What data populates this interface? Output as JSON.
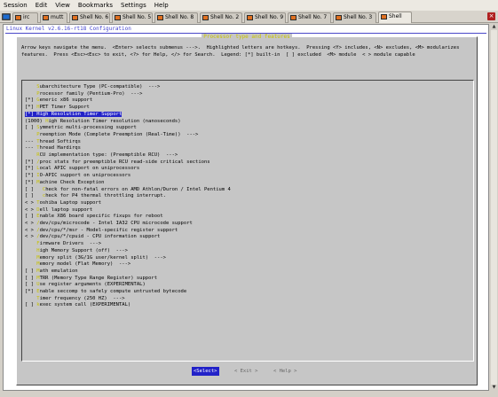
{
  "menubar": [
    "Session",
    "Edit",
    "View",
    "Bookmarks",
    "Settings",
    "Help"
  ],
  "tabs": [
    {
      "label": "irc",
      "active": false
    },
    {
      "label": "mutt",
      "active": false
    },
    {
      "label": "Shell No. 6",
      "active": false
    },
    {
      "label": "Shell No. 5",
      "active": false
    },
    {
      "label": "Shell No. 8",
      "active": false
    },
    {
      "label": "Shell No. 2",
      "active": false
    },
    {
      "label": "Shell No. 9",
      "active": false
    },
    {
      "label": "Shell No. 7",
      "active": false
    },
    {
      "label": "Shell No. 3",
      "active": false
    },
    {
      "label": "Shell",
      "active": true
    }
  ],
  "terminal": {
    "title": "Linux Kernel v2.6.16-rt18 Configuration",
    "dialog_title": "Processor type and features",
    "help": "Arrow keys navigate the menu.  <Enter> selects submenus --->.  Highlighted letters are hotkeys.  Pressing <Y> includes, <N> excludes, <M> modularizes features.  Press <Esc><Esc> to exit, <?> for Help, </> for Search.  Legend: [*] built-in  [ ] excluded  <M> module  < > module capable",
    "items": [
      {
        "prefix": "    ",
        "hotkey": "S",
        "text": "ubarchitecture Type (PC-compatible)  --->",
        "selected": false
      },
      {
        "prefix": "    ",
        "hotkey": "P",
        "text": "rocessor family (Pentium-Pro)  --->",
        "selected": false
      },
      {
        "prefix": "[*] ",
        "hotkey": "G",
        "text": "eneric x86 support",
        "selected": false
      },
      {
        "prefix": "[*] ",
        "hotkey": "H",
        "text": "PET Timer Support",
        "selected": false
      },
      {
        "prefix": "[*] ",
        "hotkey": "H",
        "text": "igh Resolution Timer Support",
        "selected": true
      },
      {
        "prefix": "(1000) ",
        "hotkey": "H",
        "text": "igh Resolution Timer resolution (nanoseconds)",
        "selected": false
      },
      {
        "prefix": "[ ] ",
        "hotkey": "S",
        "text": "ymmetric multi-processing support",
        "selected": false
      },
      {
        "prefix": "    ",
        "hotkey": "P",
        "text": "reemption Mode (Complete Preemption (Real-Time))  --->",
        "selected": false
      },
      {
        "prefix": "--- ",
        "hotkey": "T",
        "text": "hread Softirqs",
        "selected": false
      },
      {
        "prefix": "--- ",
        "hotkey": "T",
        "text": "hread Hardirqs",
        "selected": false
      },
      {
        "prefix": "    ",
        "hotkey": "R",
        "text": "CU implementation type: (Preemptible RCU)  --->",
        "selected": false
      },
      {
        "prefix": "[*] ",
        "hotkey": "/",
        "text": "proc stats for preemptible RCU read-side critical sections",
        "selected": false
      },
      {
        "prefix": "[*] ",
        "hotkey": "L",
        "text": "ocal APIC support on uniprocessors",
        "selected": false
      },
      {
        "prefix": "[*] ",
        "hotkey": "I",
        "text": "O-APIC support on uniprocessors",
        "selected": false
      },
      {
        "prefix": "[*] ",
        "hotkey": "M",
        "text": "achine Check Exception",
        "selected": false
      },
      {
        "prefix": "[ ]   ",
        "hotkey": "C",
        "text": "heck for non-fatal errors on AMD Athlon/Duron / Intel Pentium 4",
        "selected": false
      },
      {
        "prefix": "[ ]   ",
        "hotkey": "c",
        "text": "heck for P4 thermal throttling interrupt.",
        "selected": false
      },
      {
        "prefix": "< > ",
        "hotkey": "T",
        "text": "oshiba Laptop support",
        "selected": false
      },
      {
        "prefix": "< > ",
        "hotkey": "D",
        "text": "ell laptop support",
        "selected": false
      },
      {
        "prefix": "[ ] ",
        "hotkey": "E",
        "text": "nable X86 board specific fixups for reboot",
        "selected": false
      },
      {
        "prefix": "< > ",
        "hotkey": "/",
        "text": "dev/cpu/microcode - Intel IA32 CPU microcode support",
        "selected": false
      },
      {
        "prefix": "< > ",
        "hotkey": "/",
        "text": "dev/cpu/*/msr - Model-specific register support",
        "selected": false
      },
      {
        "prefix": "< > ",
        "hotkey": "/",
        "text": "dev/cpu/*/cpuid - CPU information support",
        "selected": false
      },
      {
        "prefix": "    ",
        "hotkey": "F",
        "text": "irmware Drivers  --->",
        "selected": false
      },
      {
        "prefix": "    ",
        "hotkey": "H",
        "text": "igh Memory Support (off)  --->",
        "selected": false
      },
      {
        "prefix": "    ",
        "hotkey": "M",
        "text": "emory split (3G/1G user/kernel split)  --->",
        "selected": false
      },
      {
        "prefix": "    ",
        "hotkey": "M",
        "text": "emory model (Flat Memory)  --->",
        "selected": false
      },
      {
        "prefix": "[ ] ",
        "hotkey": "M",
        "text": "ath emulation",
        "selected": false
      },
      {
        "prefix": "[ ] ",
        "hotkey": "M",
        "text": "TRR (Memory Type Range Register) support",
        "selected": false
      },
      {
        "prefix": "[ ] ",
        "hotkey": "U",
        "text": "se register arguments (EXPERIMENTAL)",
        "selected": false
      },
      {
        "prefix": "[*] ",
        "hotkey": "E",
        "text": "nable seccomp to safely compute untrusted bytecode",
        "selected": false
      },
      {
        "prefix": "    ",
        "hotkey": "T",
        "text": "imer frequency (250 HZ)  --->",
        "selected": false
      },
      {
        "prefix": "[ ] ",
        "hotkey": "k",
        "text": "exec system call (EXPERIMENTAL)",
        "selected": false
      }
    ],
    "buttons": {
      "select": "<Select>",
      "exit": "< Exit >",
      "help": "< Help >"
    }
  },
  "colors": {
    "hotkey": "#c8c200",
    "selection": "#2222c8",
    "dialog": "#c6c6c6"
  },
  "icons": {
    "new_tab": "konsole-new-tab-icon",
    "tab": "terminal-icon",
    "close": "close-tab-icon"
  }
}
